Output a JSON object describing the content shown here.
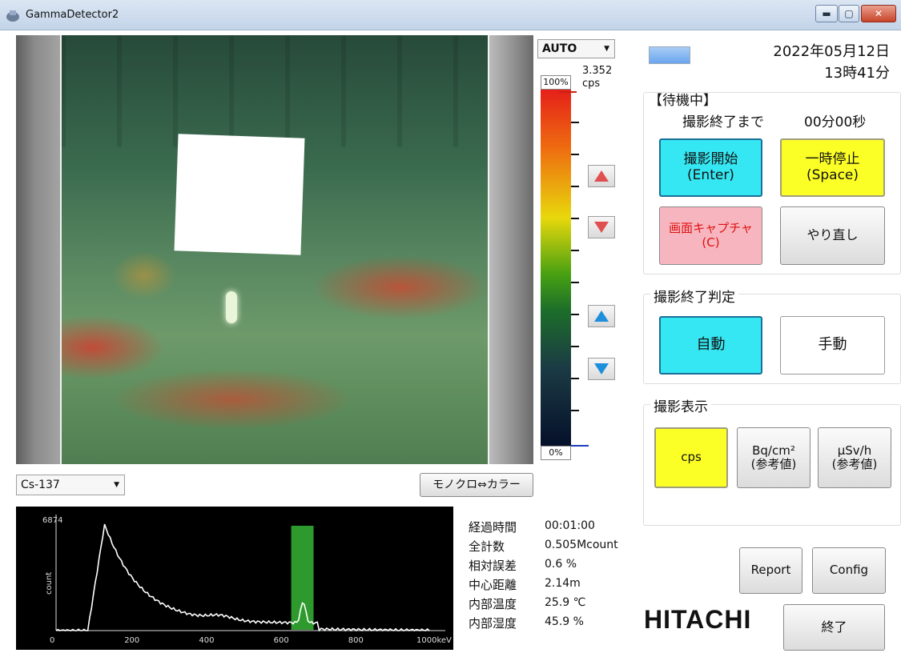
{
  "window": {
    "title": "GammaDetector2",
    "min_glyph": "▬",
    "max_glyph": "▢",
    "close_glyph": "✕"
  },
  "scale": {
    "mode": "AUTO",
    "max_value": "3.352",
    "unit": "cps",
    "top_label": "100%",
    "bottom_label": "0%",
    "colors": [
      "#e5201a",
      "#e8d80c",
      "#47a012",
      "#1b3b44",
      "#05102a"
    ]
  },
  "header": {
    "date": "2022年05月12日",
    "time": "13時41分",
    "progress_fraction": 0.0
  },
  "capture": {
    "status": "【待機中】",
    "remaining_label": "撮影終了まで",
    "remaining_value": "00分00秒",
    "start_line1": "撮影開始",
    "start_line2": "(Enter)",
    "pause_line1": "一時停止",
    "pause_line2": "(Space)",
    "screenshot_line1": "画面キャプチャ",
    "screenshot_line2": "(C)",
    "redo": "やり直し"
  },
  "end_judgment": {
    "title": "撮影終了判定",
    "auto": "自動",
    "manual": "手動"
  },
  "display": {
    "title": "撮影表示",
    "cps": "cps",
    "bq_line1": "Bq/cm²",
    "bq_line2": "(参考値)",
    "usv_line1": "μSv/h",
    "usv_line2": "(参考値)"
  },
  "isotope": {
    "selected": "Cs-137"
  },
  "mono_color_button": "モノクロ⇔カラー",
  "spectrum": {
    "ymax_label": "6874",
    "ylabel": "count",
    "ticks": [
      "0",
      "200",
      "400",
      "600",
      "800",
      "1000keV"
    ],
    "window_kev": [
      630,
      690
    ],
    "window_color": "#2e9a2e"
  },
  "stats": [
    {
      "label": "経過時間",
      "value": "00:01:00"
    },
    {
      "label": "全計数",
      "value": "0.505Mcount"
    },
    {
      "label": "相対誤差",
      "value": "0.6 %"
    },
    {
      "label": "中心距離",
      "value": "2.14m"
    },
    {
      "label": "内部温度",
      "value": "25.9 ℃"
    },
    {
      "label": "内部湿度",
      "value": "45.9 %"
    }
  ],
  "footer": {
    "report": "Report",
    "config": "Config",
    "exit": "終了",
    "logo": "HITACHI"
  }
}
